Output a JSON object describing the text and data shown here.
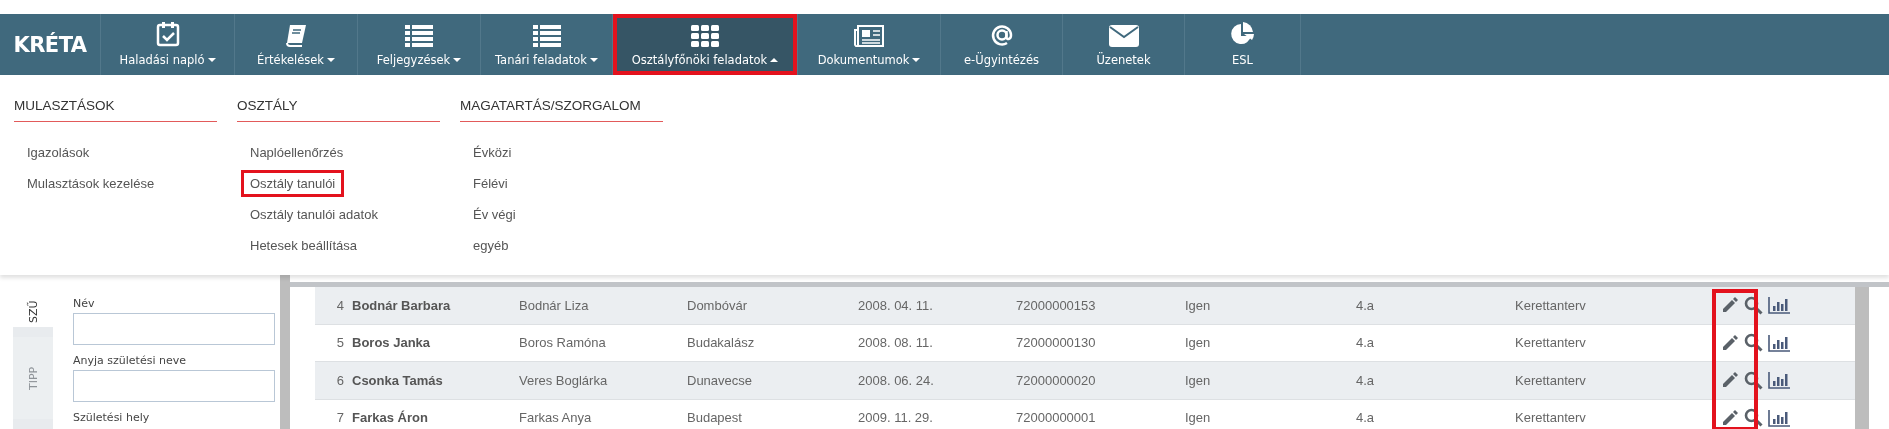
{
  "logo": {
    "text": "KRÉTA"
  },
  "nav": [
    {
      "label": "Haladási napló",
      "kind": "calendar",
      "has_caret": true,
      "selected": false,
      "highlighted": false
    },
    {
      "label": "Értékelések",
      "kind": "book",
      "has_caret": true,
      "selected": false,
      "highlighted": false
    },
    {
      "label": "Feljegyzések",
      "kind": "list",
      "has_caret": true,
      "selected": false,
      "highlighted": false
    },
    {
      "label": "Tanári feladatok",
      "kind": "list",
      "has_caret": true,
      "selected": false,
      "highlighted": false
    },
    {
      "label": "Osztályfőnöki feladatok",
      "kind": "grid",
      "has_caret": true,
      "selected": true,
      "highlighted": true
    },
    {
      "label": "Dokumentumok",
      "kind": "newspaper",
      "has_caret": true,
      "selected": false,
      "highlighted": false
    },
    {
      "label": "e-Ügyintézés",
      "kind": "at",
      "has_caret": false,
      "selected": false,
      "highlighted": false
    },
    {
      "label": "Üzenetek",
      "kind": "envelope",
      "has_caret": false,
      "selected": false,
      "highlighted": false
    },
    {
      "label": "ESL",
      "kind": "pie",
      "has_caret": false,
      "selected": false,
      "highlighted": false
    }
  ],
  "dropdown": {
    "columns": [
      {
        "heading": "MULASZTÁSOK",
        "items": [
          {
            "label": "Igazolások",
            "highlighted": false
          },
          {
            "label": "Mulasztások kezelése",
            "highlighted": false
          }
        ]
      },
      {
        "heading": "OSZTÁLY",
        "items": [
          {
            "label": "Naplóellenőrzés",
            "highlighted": false
          },
          {
            "label": "Osztály tanulói",
            "highlighted": true
          },
          {
            "label": "Osztály tanulói adatok",
            "highlighted": false
          },
          {
            "label": "Hetesek beállítása",
            "highlighted": false
          }
        ]
      },
      {
        "heading": "MAGATARTÁS/SZORGALOM",
        "items": [
          {
            "label": "Évközi",
            "highlighted": false
          },
          {
            "label": "Félévi",
            "highlighted": false
          },
          {
            "label": "Év végi",
            "highlighted": false
          },
          {
            "label": "egyéb",
            "highlighted": false
          }
        ]
      }
    ]
  },
  "side_tabs": [
    {
      "label": "SZŰ",
      "selected": true
    },
    {
      "label": "TIPP",
      "selected": false
    }
  ],
  "filter_form": {
    "fields": [
      {
        "label": "Név"
      },
      {
        "label": "Anyja születési neve"
      },
      {
        "label": "Születési hely"
      }
    ]
  },
  "table": {
    "actions_highlighted": true,
    "rows": [
      {
        "no": "4",
        "name": "Bodnár Barbara",
        "mother": "Bodnár Liza",
        "birthplace": "Dombóvár",
        "birthdate": "2008. 04. 11.",
        "student_id": "72000000153",
        "column_7": "Igen",
        "class": "4.a",
        "curriculum": "Kerettanterv"
      },
      {
        "no": "5",
        "name": "Boros Janka",
        "mother": "Boros Ramóna",
        "birthplace": "Budakalász",
        "birthdate": "2008. 08. 11.",
        "student_id": "72000000130",
        "column_7": "Igen",
        "class": "4.a",
        "curriculum": "Kerettanterv"
      },
      {
        "no": "6",
        "name": "Csonka Tamás",
        "mother": "Veres Boglárka",
        "birthplace": "Dunavecse",
        "birthdate": "2008. 06. 24.",
        "student_id": "72000000020",
        "column_7": "Igen",
        "class": "4.a",
        "curriculum": "Kerettanterv"
      },
      {
        "no": "7",
        "name": "Farkas Áron",
        "mother": "Farkas Anya",
        "birthplace": "Budapest",
        "birthdate": "2009. 11. 29.",
        "student_id": "72000000001",
        "column_7": "Igen",
        "class": "4.a",
        "curriculum": "Kerettanterv"
      }
    ]
  }
}
